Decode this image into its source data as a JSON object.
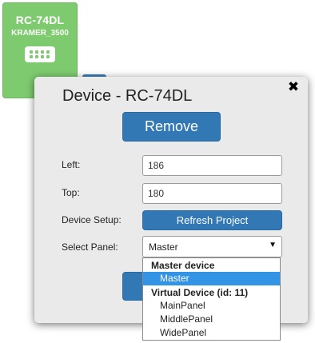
{
  "tile": {
    "name": "RC-74DL",
    "subtitle": "KRAMER_3500",
    "icon": "keypad-icon",
    "color": "#7ecb6f"
  },
  "dialog": {
    "title": "Device - RC-74DL",
    "close_icon": "close-icon",
    "remove_label": "Remove",
    "fields": {
      "left_label": "Left:",
      "left_value": "186",
      "top_label": "Top:",
      "top_value": "180",
      "setup_label": "Device Setup:",
      "refresh_label": "Refresh Project",
      "panel_label": "Select Panel:",
      "panel_value": "Master"
    },
    "accent": "#3178b5"
  },
  "dropdown": {
    "groups": [
      {
        "label": "Master device",
        "options": [
          "Master"
        ]
      },
      {
        "label": "Virtual Device (id: 11)",
        "options": [
          "MainPanel",
          "MiddlePanel",
          "WidePanel"
        ]
      }
    ],
    "selected": "Master",
    "highlight": "#3393e5"
  }
}
